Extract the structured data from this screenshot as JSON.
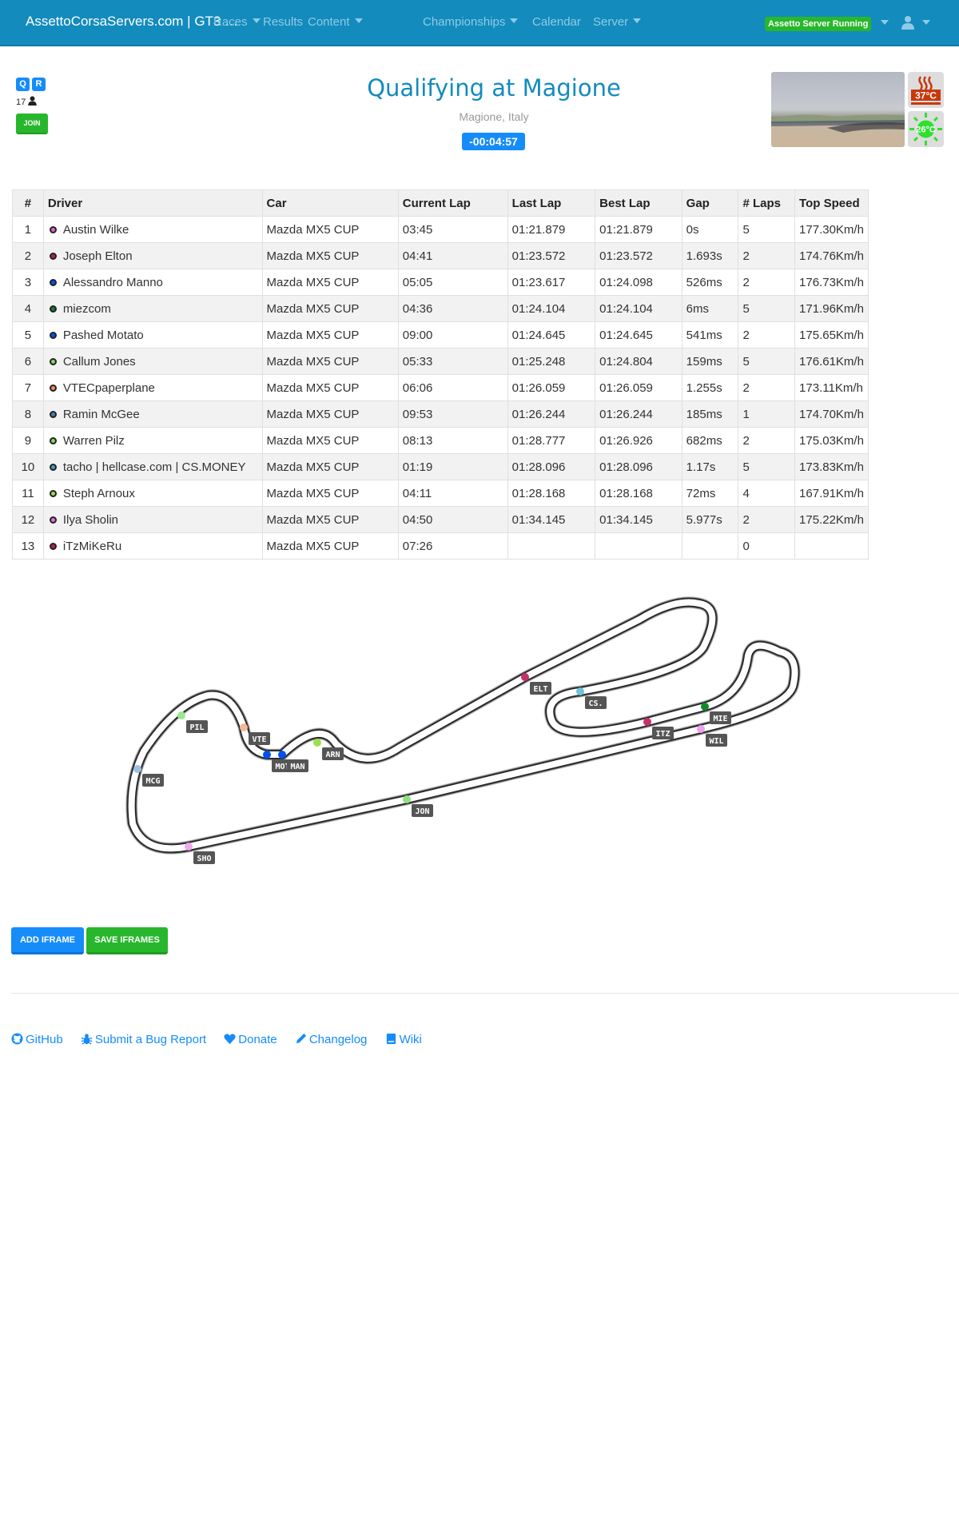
{
  "navbar": {
    "brand": "AssettoCorsaServers.com | GT3 …",
    "items": [
      {
        "label": "Races",
        "dropdown": true
      },
      {
        "label": "Results",
        "dropdown": false
      },
      {
        "label": "Content",
        "dropdown": true
      },
      {
        "label": "Championships",
        "dropdown": true
      },
      {
        "label": "Calendar",
        "dropdown": false
      },
      {
        "label": "Server",
        "dropdown": true
      }
    ],
    "server_status": "Assetto Server Running",
    "user_icon": "user-icon"
  },
  "session": {
    "badges": [
      "Q",
      "R"
    ],
    "player_count": "17",
    "join_label": "JOIN",
    "title": "Qualifying at Magione",
    "location": "Magione, Italy",
    "timer": "-00:04:57",
    "ambient_temp": "37°C",
    "road_temp": "26°C"
  },
  "table": {
    "headers": [
      "#",
      "Driver",
      "Car",
      "Current Lap",
      "Last Lap",
      "Best Lap",
      "Gap",
      "# Laps",
      "Top Speed"
    ],
    "rows": [
      {
        "pos": "1",
        "driver": "Austin Wilke",
        "color": "#e05ee0",
        "car": "Mazda MX5 CUP",
        "current": "03:45",
        "last": "01:21.879",
        "best": "01:21.879",
        "gap": "0s",
        "laps": "5",
        "speed": "177.30Km/h"
      },
      {
        "pos": "2",
        "driver": "Joseph Elton",
        "color": "#b5204f",
        "car": "Mazda MX5 CUP",
        "current": "04:41",
        "last": "01:23.572",
        "best": "01:23.572",
        "gap": "1.693s",
        "laps": "2",
        "speed": "174.76Km/h"
      },
      {
        "pos": "3",
        "driver": "Alessandro Manno",
        "color": "#0050f0",
        "car": "Mazda MX5 CUP",
        "current": "05:05",
        "last": "01:23.617",
        "best": "01:24.098",
        "gap": "526ms",
        "laps": "2",
        "speed": "176.73Km/h"
      },
      {
        "pos": "4",
        "driver": "miezcom",
        "color": "#127a2a",
        "car": "Mazda MX5 CUP",
        "current": "04:36",
        "last": "01:24.104",
        "best": "01:24.104",
        "gap": "6ms",
        "laps": "5",
        "speed": "171.96Km/h"
      },
      {
        "pos": "5",
        "driver": "Pashed Motato",
        "color": "#0050f0",
        "car": "Mazda MX5 CUP",
        "current": "09:00",
        "last": "01:24.645",
        "best": "01:24.645",
        "gap": "541ms",
        "laps": "2",
        "speed": "175.65Km/h"
      },
      {
        "pos": "6",
        "driver": "Callum Jones",
        "color": "#7fdc5a",
        "car": "Mazda MX5 CUP",
        "current": "05:33",
        "last": "01:25.248",
        "best": "01:24.804",
        "gap": "159ms",
        "laps": "5",
        "speed": "176.61Km/h"
      },
      {
        "pos": "7",
        "driver": "VTECpaperplane",
        "color": "#f08a5d",
        "car": "Mazda MX5 CUP",
        "current": "06:06",
        "last": "01:26.059",
        "best": "01:26.059",
        "gap": "1.255s",
        "laps": "2",
        "speed": "173.11Km/h"
      },
      {
        "pos": "8",
        "driver": "Ramin McGee",
        "color": "#4a7ab0",
        "car": "Mazda MX5 CUP",
        "current": "09:53",
        "last": "01:26.244",
        "best": "01:26.244",
        "gap": "185ms",
        "laps": "1",
        "speed": "174.70Km/h"
      },
      {
        "pos": "9",
        "driver": "Warren Pilz",
        "color": "#7fdc5a",
        "car": "Mazda MX5 CUP",
        "current": "08:13",
        "last": "01:28.777",
        "best": "01:26.926",
        "gap": "682ms",
        "laps": "2",
        "speed": "175.03Km/h"
      },
      {
        "pos": "10",
        "driver": "tacho | hellcase.com | CS.MONEY",
        "color": "#3a9fc0",
        "car": "Mazda MX5 CUP",
        "current": "01:19",
        "last": "01:28.096",
        "best": "01:28.096",
        "gap": "1.17s",
        "laps": "5",
        "speed": "173.83Km/h"
      },
      {
        "pos": "11",
        "driver": "Steph Arnoux",
        "color": "#9ae04a",
        "car": "Mazda MX5 CUP",
        "current": "04:11",
        "last": "01:28.168",
        "best": "01:28.168",
        "gap": "72ms",
        "laps": "4",
        "speed": "167.91Km/h"
      },
      {
        "pos": "12",
        "driver": "Ilya Sholin",
        "color": "#e070e8",
        "car": "Mazda MX5 CUP",
        "current": "04:50",
        "last": "01:34.145",
        "best": "01:34.145",
        "gap": "5.977s",
        "laps": "2",
        "speed": "175.22Km/h"
      },
      {
        "pos": "13",
        "driver": "iTzMiKeRu",
        "color": "#b5204f",
        "car": "Mazda MX5 CUP",
        "current": "07:26",
        "last": "",
        "best": "",
        "gap": "",
        "laps": "0",
        "speed": ""
      }
    ]
  },
  "map": {
    "markers": [
      {
        "label": "ELT",
        "color": "#c8306a"
      },
      {
        "label": "CS.",
        "color": "#6ec3d8"
      },
      {
        "label": "ITZ",
        "color": "#c8306a"
      },
      {
        "label": "MIE",
        "color": "#138a2a"
      },
      {
        "label": "WIL",
        "color": "#f0a0f0"
      },
      {
        "label": "JON",
        "color": "#90e080"
      },
      {
        "label": "SHO",
        "color": "#f0a8f0"
      },
      {
        "label": "MCG",
        "color": "#9ec0e0"
      },
      {
        "label": "PIL",
        "color": "#9ae890"
      },
      {
        "label": "VTE",
        "color": "#f5b898"
      },
      {
        "label": "MOT",
        "color": "#0050f0"
      },
      {
        "label": "MAN",
        "color": "#0050f0"
      },
      {
        "label": "ARN",
        "color": "#9ae050"
      }
    ]
  },
  "actions": {
    "add_iframe": "ADD IFRAME",
    "save_iframes": "SAVE IFRAMES"
  },
  "footer": {
    "links": [
      {
        "label": "GitHub",
        "icon": "github-icon"
      },
      {
        "label": "Submit a Bug Report",
        "icon": "bug-icon"
      },
      {
        "label": "Donate",
        "icon": "heart-icon"
      },
      {
        "label": "Changelog",
        "icon": "pencil-icon"
      },
      {
        "label": "Wiki",
        "icon": "book-icon"
      }
    ]
  }
}
